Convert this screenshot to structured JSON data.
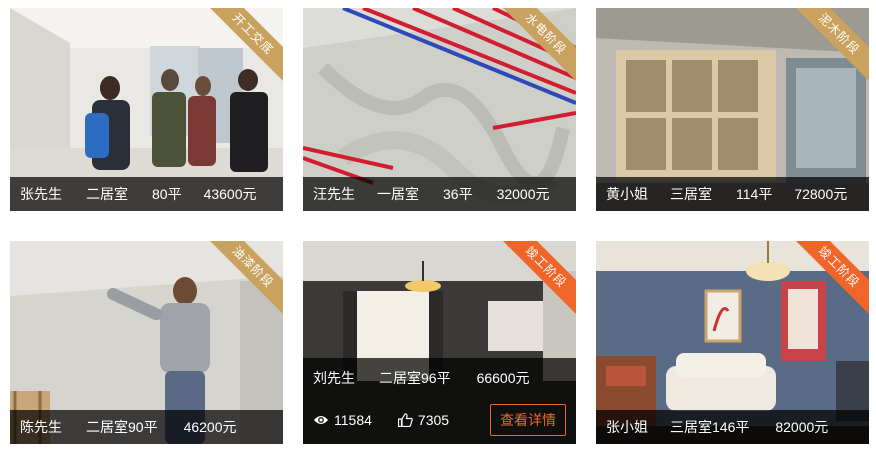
{
  "cards": [
    {
      "stage": "开工交底",
      "name": "张先生",
      "layout": "二居室",
      "area": "80平",
      "price": "43600元",
      "stage_color": "#c9a25f"
    },
    {
      "stage": "水电阶段",
      "name": "汪先生",
      "layout": "一居室",
      "area": "36平",
      "price": "32000元",
      "stage_color": "#c9a25f"
    },
    {
      "stage": "泥木阶段",
      "name": "黄小姐",
      "layout": "三居室",
      "area": "114平",
      "price": "72800元",
      "stage_color": "#c9a25f"
    },
    {
      "stage": "油漆阶段",
      "name": "陈先生",
      "layout": "二居室90平",
      "price": "46200元",
      "stage_color": "#c9a25f"
    },
    {
      "stage": "竣工阶段",
      "name": "刘先生",
      "layout": "二居室96平",
      "price": "66600元",
      "views": "11584",
      "likes": "7305",
      "detail_label": "查看详情",
      "stage_color": "#f0662a"
    },
    {
      "stage": "竣工阶段",
      "name": "张小姐",
      "layout": "三居室146平",
      "price": "82000元",
      "stage_color": "#f0662a"
    }
  ]
}
